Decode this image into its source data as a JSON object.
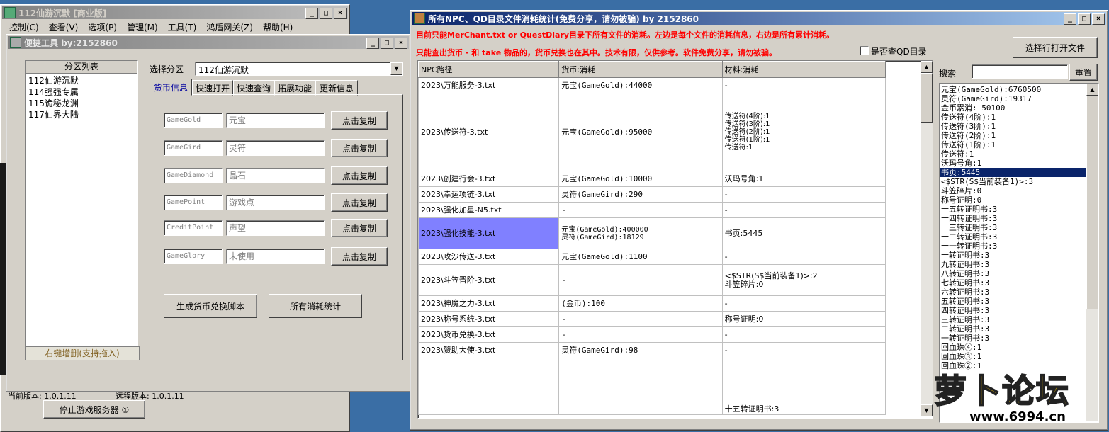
{
  "main_window": {
    "title": "112仙游沉默 [商业版]",
    "menu": [
      "控制(C)",
      "查看(V)",
      "选项(P)",
      "管理(M)",
      "工具(T)",
      "鸿盾网关(Z)",
      "帮助(H)"
    ],
    "status_current": "当前版本: 1.0.1.11",
    "status_remote": "远程版本: 1.0.1.11",
    "stop_button": "停止游戏服务器 ①"
  },
  "tool_window": {
    "title": "便捷工具   by:2152860",
    "zone_list_header": "分区列表",
    "zones": [
      "112仙游沉默",
      "114强强专属",
      "115诡秘龙渊",
      "117仙界大陆"
    ],
    "zone_list_footer": "右键增删(支持拖入)",
    "zone_select_label": "选择分区",
    "zone_select_value": "112仙游沉默",
    "tabs": [
      "货币信息",
      "快速打开",
      "快速查询",
      "拓展功能",
      "更新信息"
    ],
    "currency_rows": [
      {
        "code": "GameGold",
        "name": "元宝",
        "button": "点击复制"
      },
      {
        "code": "GameGird",
        "name": "灵符",
        "button": "点击复制"
      },
      {
        "code": "GameDiamond",
        "name": "晶石",
        "button": "点击复制"
      },
      {
        "code": "GamePoint",
        "name": "游戏点",
        "button": "点击复制"
      },
      {
        "code": "CreditPoint",
        "name": "声望",
        "button": "点击复制"
      },
      {
        "code": "GameGlory",
        "name": "未使用",
        "button": "点击复制"
      }
    ],
    "gen_button": "生成货币兑换脚本",
    "stats_button": "所有消耗统计"
  },
  "stats_window": {
    "title": "所有NPC、QD目录文件消耗统计(免费分享，请勿被骗)    by 2152860",
    "notice1": "目前只能MerChant.txt or QuestDiary目录下所有文件的消耗。左边是每个文件的消耗信息，右边是所有累计消耗。",
    "notice2": "只能查出货币 - 和 take 物品的，货币兑换也在其中。技术有限，仅供参考。软件免费分享，请勿被骗。",
    "qd_checkbox_label": "是否查QD目录",
    "open_button": "选择行打开文件",
    "search_label": "搜索",
    "reset_button": "重置",
    "columns": [
      "NPC路径",
      "货币:消耗",
      "材料:消耗"
    ],
    "rows": [
      {
        "path": "2023\\万能服务-3.txt",
        "currency": "元宝(GameGold):44000",
        "material": "-"
      },
      {
        "path": "2023\\传送符-3.txt",
        "currency": "元宝(GameGold):95000",
        "material": "传送符(4阶):1\n传送符(3阶):1\n传送符(2阶):1\n传送符(1阶):1\n传送符:1"
      },
      {
        "path": "2023\\创建行会-3.txt",
        "currency": "元宝(GameGold):10000",
        "material": "沃玛号角:1"
      },
      {
        "path": "2023\\幸运项链-3.txt",
        "currency": "灵符(GameGird):290",
        "material": "-"
      },
      {
        "path": "2023\\强化加星-N5.txt",
        "currency": "-",
        "material": "-"
      },
      {
        "path": "2023\\强化技能-3.txt",
        "currency": "元宝(GameGold):400000\n灵符(GameGird):18129",
        "material": "书页:5445"
      },
      {
        "path": "2023\\攻沙传送-3.txt",
        "currency": "元宝(GameGold):1100",
        "material": "-"
      },
      {
        "path": "2023\\斗笠晋阶-3.txt",
        "currency": "-",
        "material": "<$STR(S$当前装备1)>:2\n斗笠碎片:0"
      },
      {
        "path": "2023\\神魔之力-3.txt",
        "currency": "(金币):100",
        "material": "-"
      },
      {
        "path": "2023\\称号系统-3.txt",
        "currency": "-",
        "material": "称号证明:0"
      },
      {
        "path": "2023\\货币兑换-3.txt",
        "currency": "-",
        "material": "-"
      },
      {
        "path": "2023\\赞助大使-3.txt",
        "currency": "灵符(GameGird):98",
        "material": "-"
      },
      {
        "path": "",
        "currency": "",
        "material": "十五转证明书:3"
      }
    ],
    "totals": [
      "元宝(GameGold):6760500",
      "灵符(GameGird):19317",
      "金币累消: 50100",
      "传送符(4阶):1",
      "传送符(3阶):1",
      "传送符(2阶):1",
      "传送符(1阶):1",
      "传送符:1",
      "沃玛号角:1",
      "书页:5445",
      "<$STR(S$当前装备1)>:3",
      "斗笠碎片:0",
      "称号证明:0",
      "十五转证明书:3",
      "十四转证明书:3",
      "十三转证明书:3",
      "十二转证明书:3",
      "十一转证明书:3",
      "十转证明书:3",
      "九转证明书:3",
      "八转证明书:3",
      "七转证明书:3",
      "六转证明书:3",
      "五转证明书:3",
      "四转证明书:3",
      "三转证明书:3",
      "二转证明书:3",
      "一转证明书:3",
      "回血珠④:1",
      "回血珠③:1",
      "回血珠②:1"
    ]
  },
  "watermark": {
    "text": "萝卜论坛",
    "url": "www.6994.cn"
  },
  "colors": {
    "title_active": "#0a246a",
    "notice_red": "#ff0000",
    "selected_cell": "#8080ff",
    "selected_list": "#0a246a"
  }
}
